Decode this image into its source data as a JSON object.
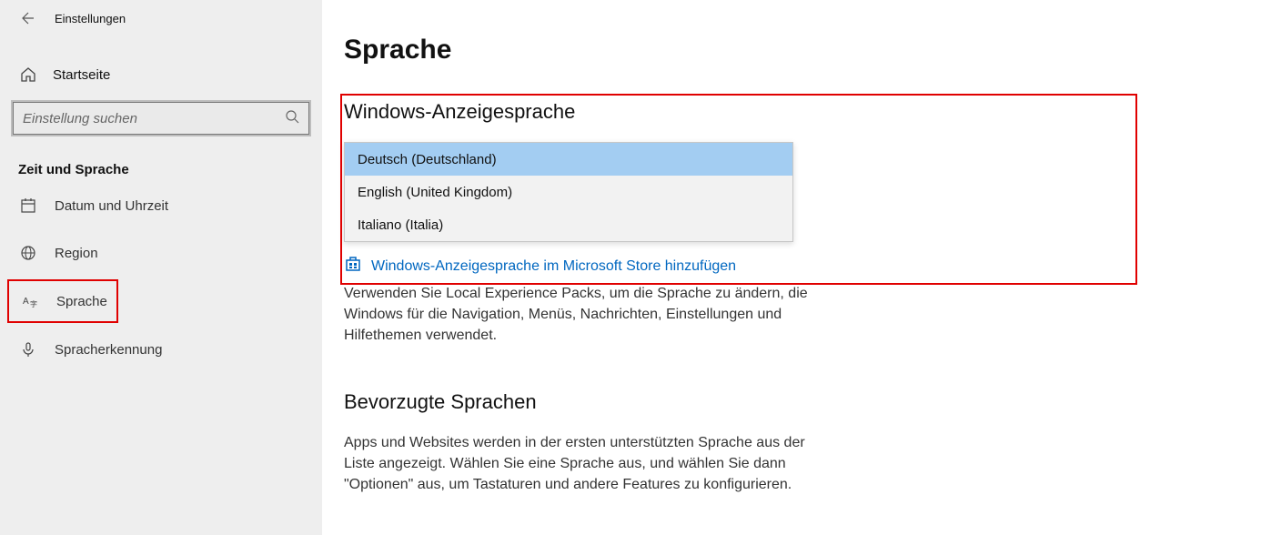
{
  "app": {
    "title": "Einstellungen"
  },
  "sidebar": {
    "home": "Startseite",
    "search_placeholder": "Einstellung suchen",
    "section": "Zeit und Sprache",
    "items": [
      {
        "label": "Datum und Uhrzeit"
      },
      {
        "label": "Region"
      },
      {
        "label": "Sprache"
      },
      {
        "label": "Spracherkennung"
      }
    ]
  },
  "main": {
    "title": "Sprache",
    "display_lang_title": "Windows-Anzeigesprache",
    "lang_options": [
      "Deutsch (Deutschland)",
      "English (United Kingdom)",
      "Italiano (Italia)"
    ],
    "store_link": "Windows-Anzeigesprache im Microsoft Store hinzufügen",
    "display_desc": "Verwenden Sie Local Experience Packs, um die Sprache zu ändern, die Windows für die Navigation, Menüs, Nachrichten, Einstellungen und Hilfethemen verwendet.",
    "preferred_title": "Bevorzugte Sprachen",
    "preferred_desc": "Apps und Websites werden in der ersten unterstützten Sprache aus der Liste angezeigt. Wählen Sie eine Sprache aus, und wählen Sie dann \"Optionen\" aus, um Tastaturen und andere Features zu konfigurieren."
  }
}
